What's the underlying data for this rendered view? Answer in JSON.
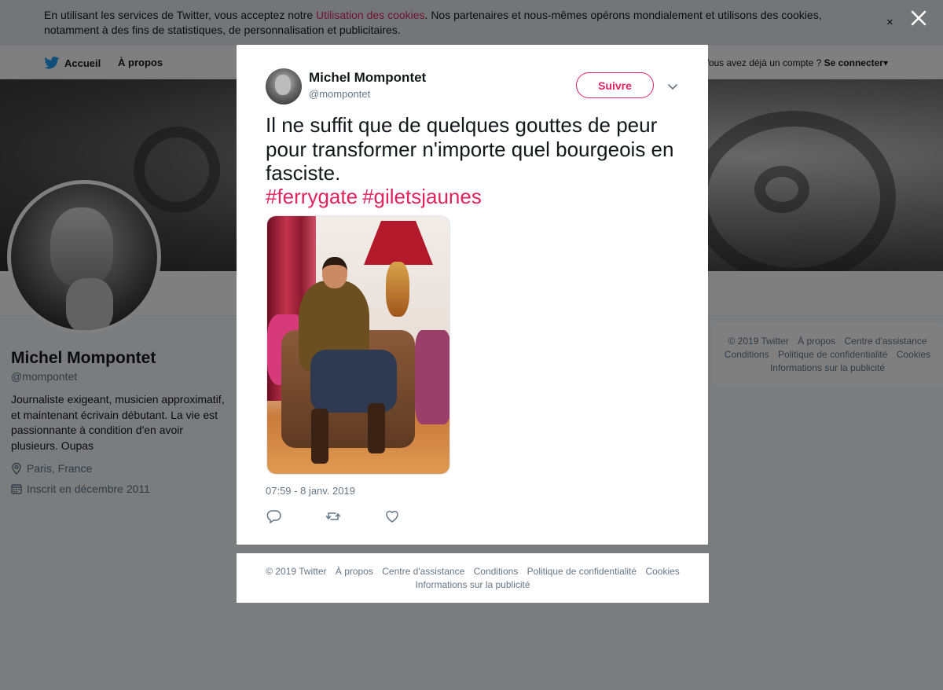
{
  "cookie_bar": {
    "text_before": "En utilisant les services de Twitter, vous acceptez notre ",
    "link": "Utilisation des cookies",
    "text_after": ". Nos partenaires et nous-mêmes opérons mondialement et utilisons des cookies, notamment à des fins de statistiques, de personnalisation et publicitaires.",
    "close": "×"
  },
  "nav": {
    "home": "Accueil",
    "about": "À propos",
    "login_prompt": "Vous avez déjà un compte ? ",
    "login": "Se connecter",
    "login_caret": "▾"
  },
  "profile": {
    "name": "Michel Mompontet",
    "handle": "@mompontet",
    "bio": "Journaliste exigeant, musicien approximatif, et maintenant écrivain débutant. La vie est passionnante à condition d'en avoir plusieurs. Oupas",
    "location": "Paris, France",
    "joined": "Inscrit en décembre 2011"
  },
  "footer": {
    "items": [
      "© 2019 Twitter",
      "À propos",
      "Centre d'assistance",
      "Conditions",
      "Politique de confidentialité",
      "Cookies"
    ],
    "ads": "Informations sur la publicité"
  },
  "tweet": {
    "author_name": "Michel Mompontet",
    "author_handle": "@mompontet",
    "follow_label": "Suivre",
    "text": "Il ne suffit que de quelques gouttes de peur pour transformer n'importe quel bourgeois en fasciste.",
    "hashtags": [
      "#ferrygate",
      "#giletsjaunes"
    ],
    "timestamp": "07:59 - 8 janv. 2019"
  },
  "colors": {
    "accent": "#e0245e",
    "twitter_blue": "#1da1f2",
    "muted": "#657786"
  }
}
